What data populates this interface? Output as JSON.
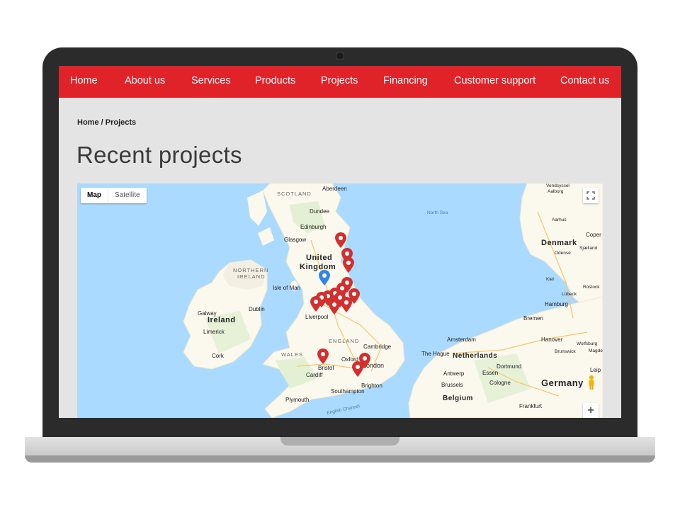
{
  "nav": {
    "items": [
      "Home",
      "About us",
      "Services",
      "Products",
      "Projects",
      "Financing",
      "Customer support",
      "Contact us"
    ]
  },
  "breadcrumb": "Home / Projects",
  "page_title": "Recent projects",
  "map": {
    "type_control": {
      "map_label": "Map",
      "satellite_label": "Satellite",
      "selected": "Map"
    },
    "labels": {
      "scotland": "SCOTLAND",
      "aberdeen": "Aberdeen",
      "dundee": "Dundee",
      "edinburgh": "Edinburgh",
      "glasgow": "Glasgow",
      "united": "United",
      "kingdom": "Kingdom",
      "northern_ireland_1": "NORTHERN",
      "northern_ireland_2": "IRELAND",
      "isle_of_man": "Isle of Man",
      "dublin": "Dublin",
      "galway": "Galway",
      "ireland": "Ireland",
      "limerick": "Limerick",
      "cork": "Cork",
      "liverpool": "Liverpool",
      "england": "ENGLAND",
      "cambridge": "Cambridge",
      "wales": "WALES",
      "oxford": "Oxford",
      "london": "London",
      "bristol": "Bristol",
      "cardiff": "Cardiff",
      "brighton": "Brighton",
      "southampton": "Southampton",
      "plymouth": "Plymouth",
      "english_channel": "English Channel",
      "north_sea": "North Sea",
      "vendsyssel": "Vendsyssel",
      "aalborg": "Aalborg",
      "aarhus": "Aarhus",
      "denmark": "Denmark",
      "copenhagen": "Coper",
      "sjaelland": "Sjælland",
      "odense": "Odense",
      "kiel": "Kiel",
      "rostock": "Rostock",
      "lubeck": "Lübeck",
      "hamburg": "Hamburg",
      "bremen": "Bremen",
      "amsterdam": "Amsterdam",
      "hanover": "Hanover",
      "wolfsburg": "Wolfsburg",
      "brunswick": "Brunswick",
      "magdeburg": "Magde",
      "the_hague": "The Hague",
      "netherlands": "Netherlands",
      "dortmund": "Dortmund",
      "antwerp": "Antwerp",
      "essen": "Essen",
      "leipzig": "Leip",
      "brussels": "Brussels",
      "cologne": "Cologne",
      "germany": "Germany",
      "belgium": "Belgium",
      "frankfurt": "Frankfurt"
    },
    "marker_colors": {
      "project": "#d32f2f",
      "highlight": "#2f86e6"
    },
    "zoom_in_label": "+"
  }
}
